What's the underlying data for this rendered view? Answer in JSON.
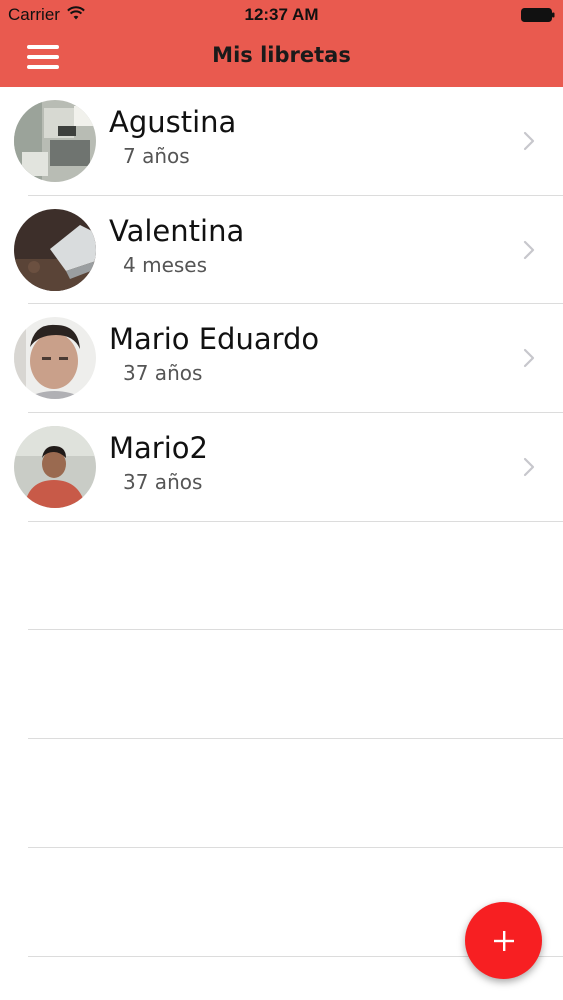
{
  "colors": {
    "header_bg": "#e95a4f",
    "fab_bg": "#f71f22",
    "divider": "#dcdcdc",
    "chevron": "#c7c7cc"
  },
  "status_bar": {
    "carrier": "Carrier",
    "time": "12:37 AM",
    "icons": [
      "wifi-icon",
      "battery-icon"
    ]
  },
  "nav": {
    "title": "Mis libretas",
    "menu_icon": "hamburger-menu-icon"
  },
  "notebooks": [
    {
      "name": "Agustina",
      "age": "7 años",
      "avatar": "avatar-photo"
    },
    {
      "name": "Valentina",
      "age": "4 meses",
      "avatar": "avatar-photo"
    },
    {
      "name": "Mario Eduardo",
      "age": "37 años",
      "avatar": "avatar-photo"
    },
    {
      "name": "Mario2",
      "age": "37 años",
      "avatar": "avatar-photo"
    }
  ],
  "fab": {
    "icon": "plus-icon"
  }
}
